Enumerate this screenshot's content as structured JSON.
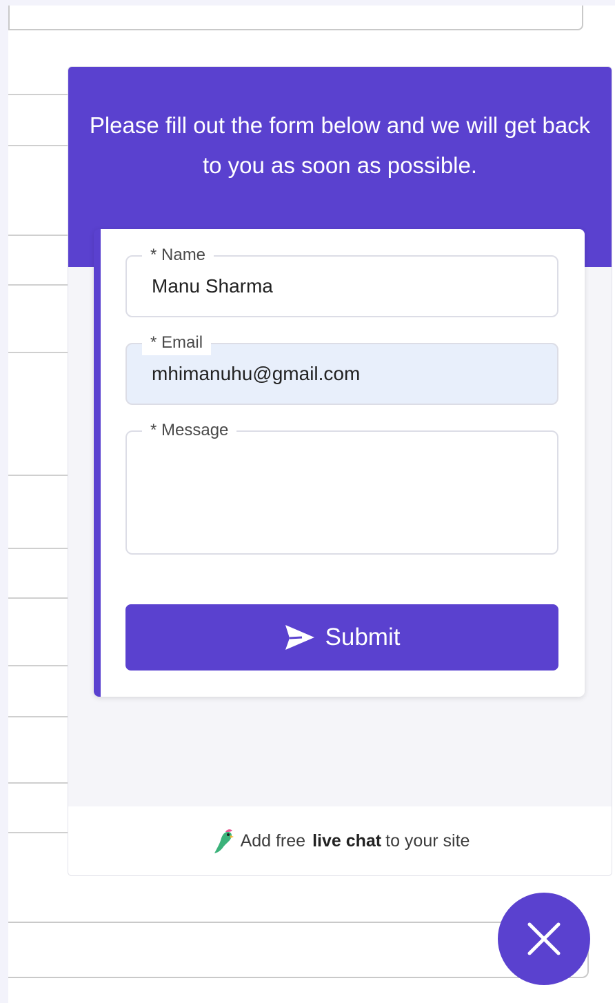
{
  "widget": {
    "header_text": "Please fill out the form below and we will get back to you as soon as possible.",
    "accent_color": "#5a41cf"
  },
  "form": {
    "name": {
      "label": "* Name",
      "value": "Manu Sharma"
    },
    "email": {
      "label": "* Email",
      "value": "mhimanuhu@gmail.com"
    },
    "message": {
      "label": "* Message",
      "value": ""
    },
    "submit": {
      "label": "Submit",
      "icon": "send-icon"
    }
  },
  "footer": {
    "prefix": "Add free",
    "bold": "live chat",
    "suffix": "to your site",
    "icon": "parrot-logo-icon"
  },
  "close_button": {
    "icon": "close-icon"
  }
}
